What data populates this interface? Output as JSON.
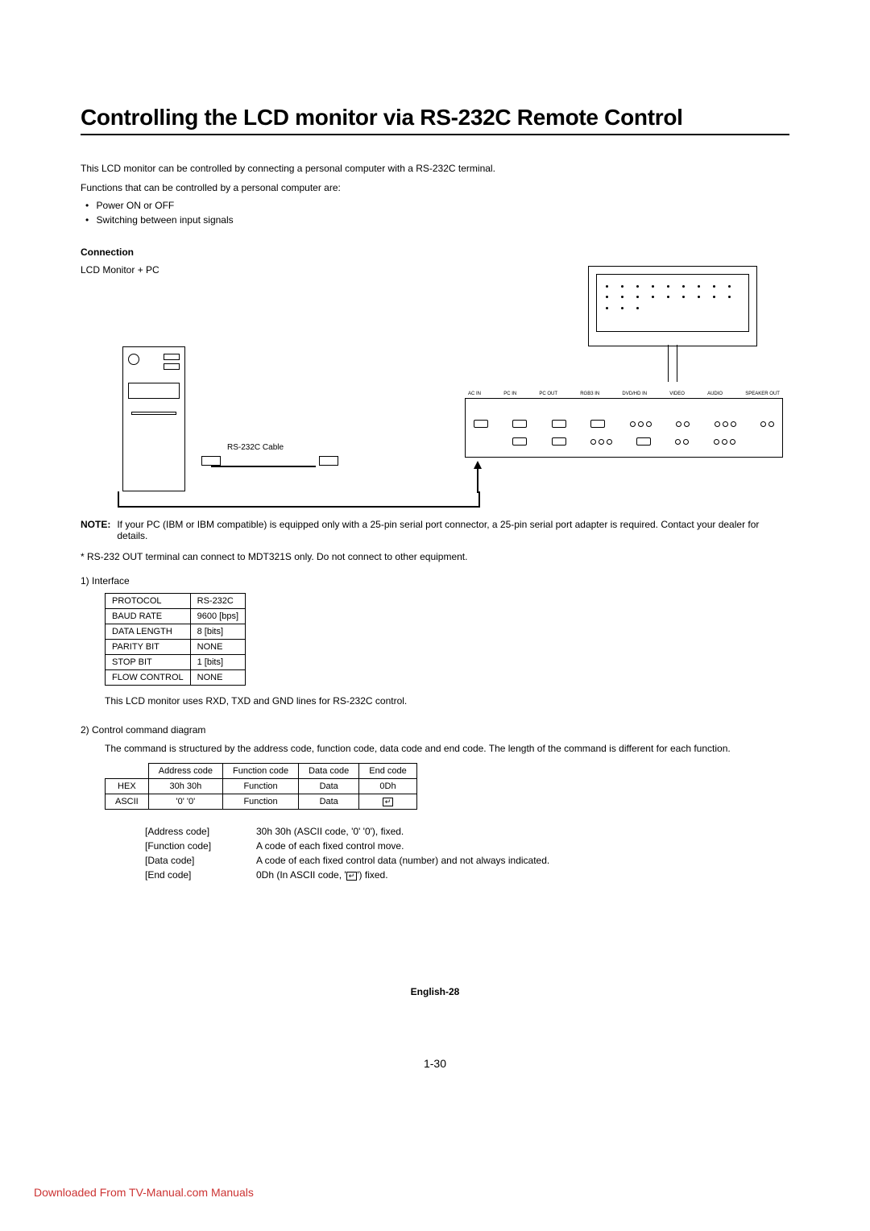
{
  "title": "Controlling the LCD monitor via RS-232C Remote Control",
  "intro1": "This LCD monitor can be controlled by connecting a personal computer with a RS-232C terminal.",
  "intro2": "Functions that can be controlled by a personal computer are:",
  "bullets": [
    "Power ON or OFF",
    "Switching between input signals"
  ],
  "connection_hd": "Connection",
  "connection_sub": "LCD Monitor + PC",
  "cable_label": "RS-232C Cable",
  "panel_labels": [
    "AC IN",
    "PC IN",
    "PC OUT",
    "RGB3 IN",
    "DVD/HD IN",
    "VIDEO",
    "AUDIO",
    "SPEAKER OUT"
  ],
  "note_label": "NOTE:",
  "note_text": "If your PC (IBM or IBM compatible) is equipped only with a 25-pin serial port connector, a 25-pin serial port adapter is required. Contact your dealer for details.",
  "star_note": "* RS-232 OUT terminal can connect to MDT321S only. Do not connect to other equipment.",
  "sec1_hd": "1)  Interface",
  "iface": [
    [
      "PROTOCOL",
      "RS-232C"
    ],
    [
      "BAUD RATE",
      "9600 [bps]"
    ],
    [
      "DATA LENGTH",
      "8 [bits]"
    ],
    [
      "PARITY BIT",
      "NONE"
    ],
    [
      "STOP BIT",
      "1 [bits]"
    ],
    [
      "FLOW CONTROL",
      "NONE"
    ]
  ],
  "sec1_note": "This LCD monitor uses RXD, TXD and GND lines for RS-232C control.",
  "sec2_hd": "2)  Control command diagram",
  "sec2_para": "The command is structured by the address code, function code, data code and end code. The length of the command is different for each function.",
  "cmd_headers": [
    "",
    "Address code",
    "Function code",
    "Data code",
    "End code"
  ],
  "cmd_rows": [
    [
      "HEX",
      "30h 30h",
      "Function",
      "Data",
      "0Dh"
    ],
    [
      "ASCII",
      "'0' '0'",
      "Function",
      "Data",
      "__ENTER__"
    ]
  ],
  "codes": [
    [
      "[Address code]",
      "30h 30h (ASCII code, '0' '0'), fixed."
    ],
    [
      "[Function code]",
      "A code of each fixed control move."
    ],
    [
      "[Data code]",
      "A code of each fixed control data (number) and not always indicated."
    ],
    [
      "[End code]",
      "0Dh (In ASCII code, '__ENTER__') fixed."
    ]
  ],
  "page_lang": "English-28",
  "page_num": "1-30",
  "download": "Downloaded From TV-Manual.com Manuals"
}
